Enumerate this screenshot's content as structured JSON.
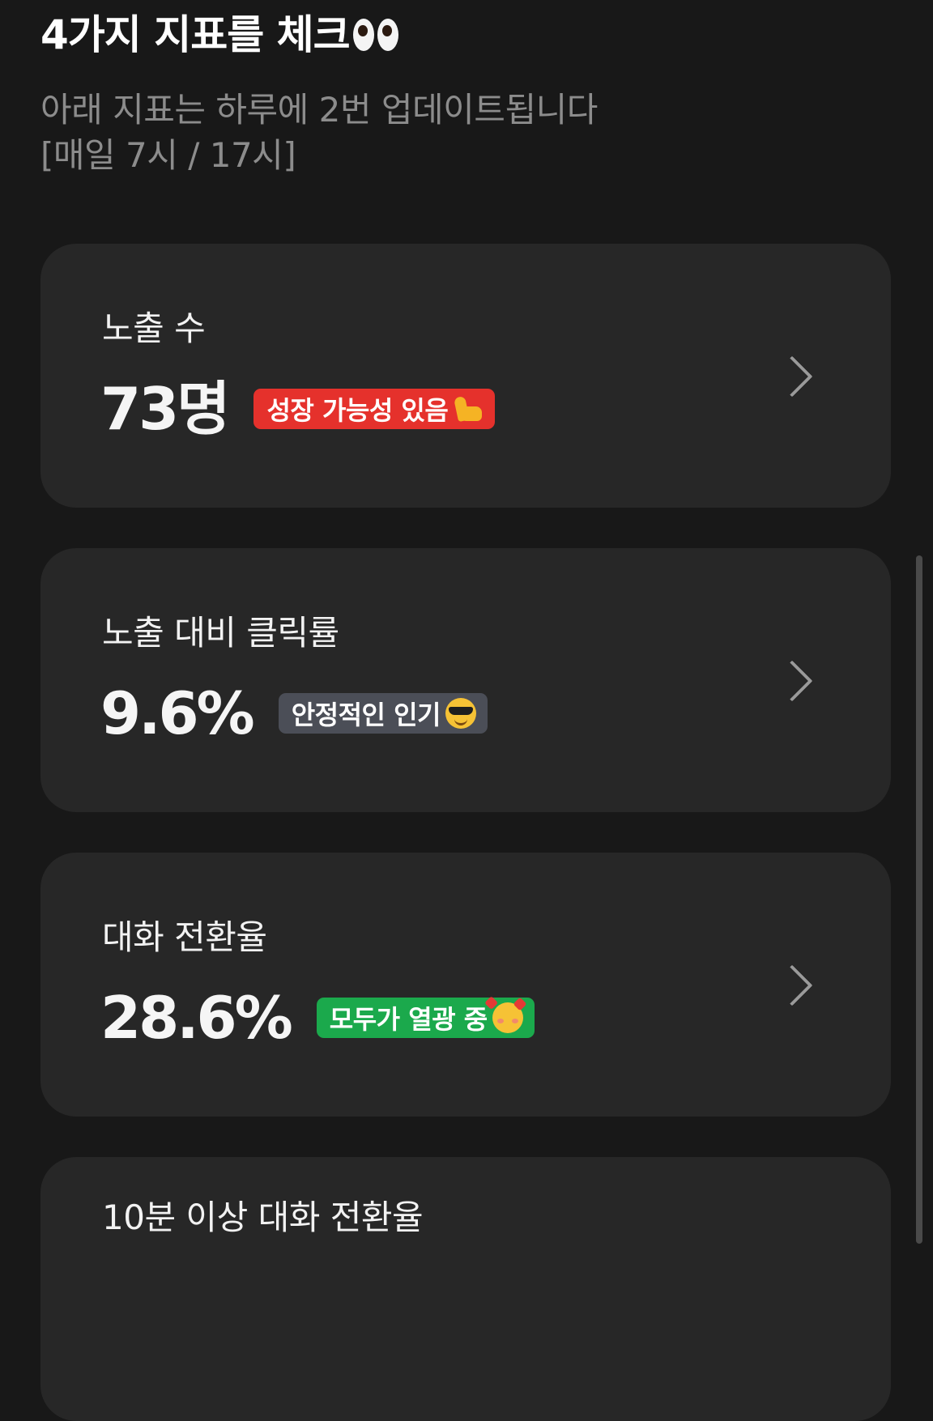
{
  "header": {
    "title": "4가지 지표를 체크",
    "title_icon": "eyes-icon",
    "subtitle_line1": "아래 지표는 하루에 2번 업데이트됩니다",
    "subtitle_line2": "[매일 7시 / 17시]"
  },
  "metrics": [
    {
      "label": "노출 수",
      "value": "73명",
      "badge": "성장 가능성 있음",
      "badge_icon": "flexed-biceps-icon",
      "badge_color": "#e5312c"
    },
    {
      "label": "노출 대비 클릭률",
      "value": "9.6%",
      "badge": "안정적인 인기",
      "badge_icon": "sunglasses-face-icon",
      "badge_color": "#4b4e57"
    },
    {
      "label": "대화 전환율",
      "value": "28.6%",
      "badge": "모두가 열광 중",
      "badge_icon": "smiling-face-with-hearts-icon",
      "badge_color": "#1ba94c"
    },
    {
      "label": "10분 이상 대화 전환율"
    }
  ],
  "colors": {
    "background": "#181818",
    "card": "#272727",
    "subtitle_text": "#8c8c8c",
    "chevron": "#9a9a9a"
  }
}
